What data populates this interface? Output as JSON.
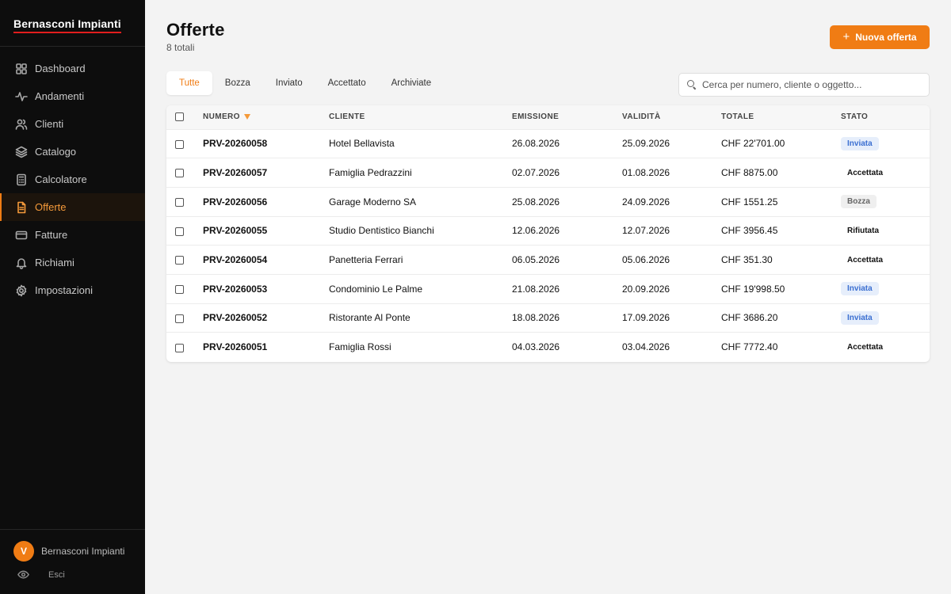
{
  "sidebar": {
    "brand": "Bernasconi Impianti",
    "items": [
      {
        "label": "Dashboard",
        "icon": "dashboard-grid-icon"
      },
      {
        "label": "Andamenti",
        "icon": "activity-line-icon"
      },
      {
        "label": "Clienti",
        "icon": "users-icon"
      },
      {
        "label": "Catalogo",
        "icon": "layers-icon"
      },
      {
        "label": "Calcolatore",
        "icon": "calculator-icon"
      },
      {
        "label": "Offerte",
        "icon": "document-icon",
        "active": true
      },
      {
        "label": "Fatture",
        "icon": "credit-card-icon"
      },
      {
        "label": "Richiami",
        "icon": "bell-icon"
      },
      {
        "label": "Impostazioni",
        "icon": "gear-icon"
      }
    ],
    "footer": {
      "avatar_initial": "V",
      "user_name": "Bernasconi Impianti",
      "logout_label": "Esci"
    }
  },
  "header": {
    "title": "Offerte",
    "count": "8 totali",
    "new_button": "Nuova offerta"
  },
  "tabs": [
    "Tutte",
    "Bozza",
    "Inviato",
    "Accettato",
    "Archiviate"
  ],
  "search": {
    "placeholder": "Cerca per numero, cliente o oggetto..."
  },
  "table": {
    "columns": [
      "NUMERO",
      "CLIENTE",
      "EMISSIONE",
      "VALIDITÀ",
      "TOTALE",
      "STATO"
    ],
    "rows": [
      {
        "numero": "PRV-20260058",
        "cliente": "Hotel Bellavista",
        "emissione": "26.08.2026",
        "validita": "25.09.2026",
        "totale": "CHF 22'701.00",
        "stato": "Inviata",
        "stato_key": "inviata"
      },
      {
        "numero": "PRV-20260057",
        "cliente": "Famiglia Pedrazzini",
        "emissione": "02.07.2026",
        "validita": "01.08.2026",
        "totale": "CHF 8875.00",
        "stato": "Accettata",
        "stato_key": "accettata"
      },
      {
        "numero": "PRV-20260056",
        "cliente": "Garage Moderno SA",
        "emissione": "25.08.2026",
        "validita": "24.09.2026",
        "totale": "CHF 1551.25",
        "stato": "Bozza",
        "stato_key": "bozza"
      },
      {
        "numero": "PRV-20260055",
        "cliente": "Studio Dentistico Bianchi",
        "emissione": "12.06.2026",
        "validita": "12.07.2026",
        "totale": "CHF 3956.45",
        "stato": "Rifiutata",
        "stato_key": "rifiutata"
      },
      {
        "numero": "PRV-20260054",
        "cliente": "Panetteria Ferrari",
        "emissione": "06.05.2026",
        "validita": "05.06.2026",
        "totale": "CHF 351.30",
        "stato": "Accettata",
        "stato_key": "accettata"
      },
      {
        "numero": "PRV-20260053",
        "cliente": "Condominio Le Palme",
        "emissione": "21.08.2026",
        "validita": "20.09.2026",
        "totale": "CHF 19'998.50",
        "stato": "Inviata",
        "stato_key": "inviata"
      },
      {
        "numero": "PRV-20260052",
        "cliente": "Ristorante Al Ponte",
        "emissione": "18.08.2026",
        "validita": "17.09.2026",
        "totale": "CHF 3686.20",
        "stato": "Inviata",
        "stato_key": "inviata"
      },
      {
        "numero": "PRV-20260051",
        "cliente": "Famiglia Rossi",
        "emissione": "04.03.2026",
        "validita": "03.04.2026",
        "totale": "CHF 7772.40",
        "stato": "Accettata",
        "stato_key": "accettata"
      }
    ]
  },
  "colors": {
    "accent": "#f07c14",
    "sidebar_bg": "#0d0d0d",
    "brand_underline": "#e11d1d",
    "status_inviata": "#3b6fd1"
  }
}
